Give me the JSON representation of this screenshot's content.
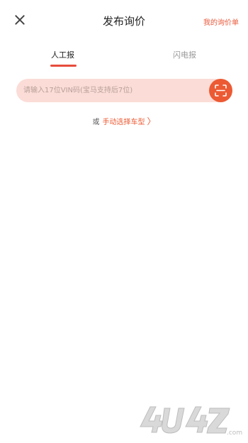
{
  "header": {
    "title": "发布询价",
    "my_quotes_label": "我的询价单"
  },
  "tabs": [
    {
      "label": "人工报",
      "active": true
    },
    {
      "label": "闪电报",
      "active": false
    }
  ],
  "vin": {
    "placeholder": "请输入17位VIN码(宝马支持后7位)"
  },
  "manual_select": {
    "prefix": "或",
    "link_label": "手动选择车型",
    "chevron": "〉"
  },
  "watermark": {
    "text": "4U4Z.com"
  },
  "colors": {
    "accent": "#ec5a33",
    "input_bg": "#fbdcd7"
  }
}
